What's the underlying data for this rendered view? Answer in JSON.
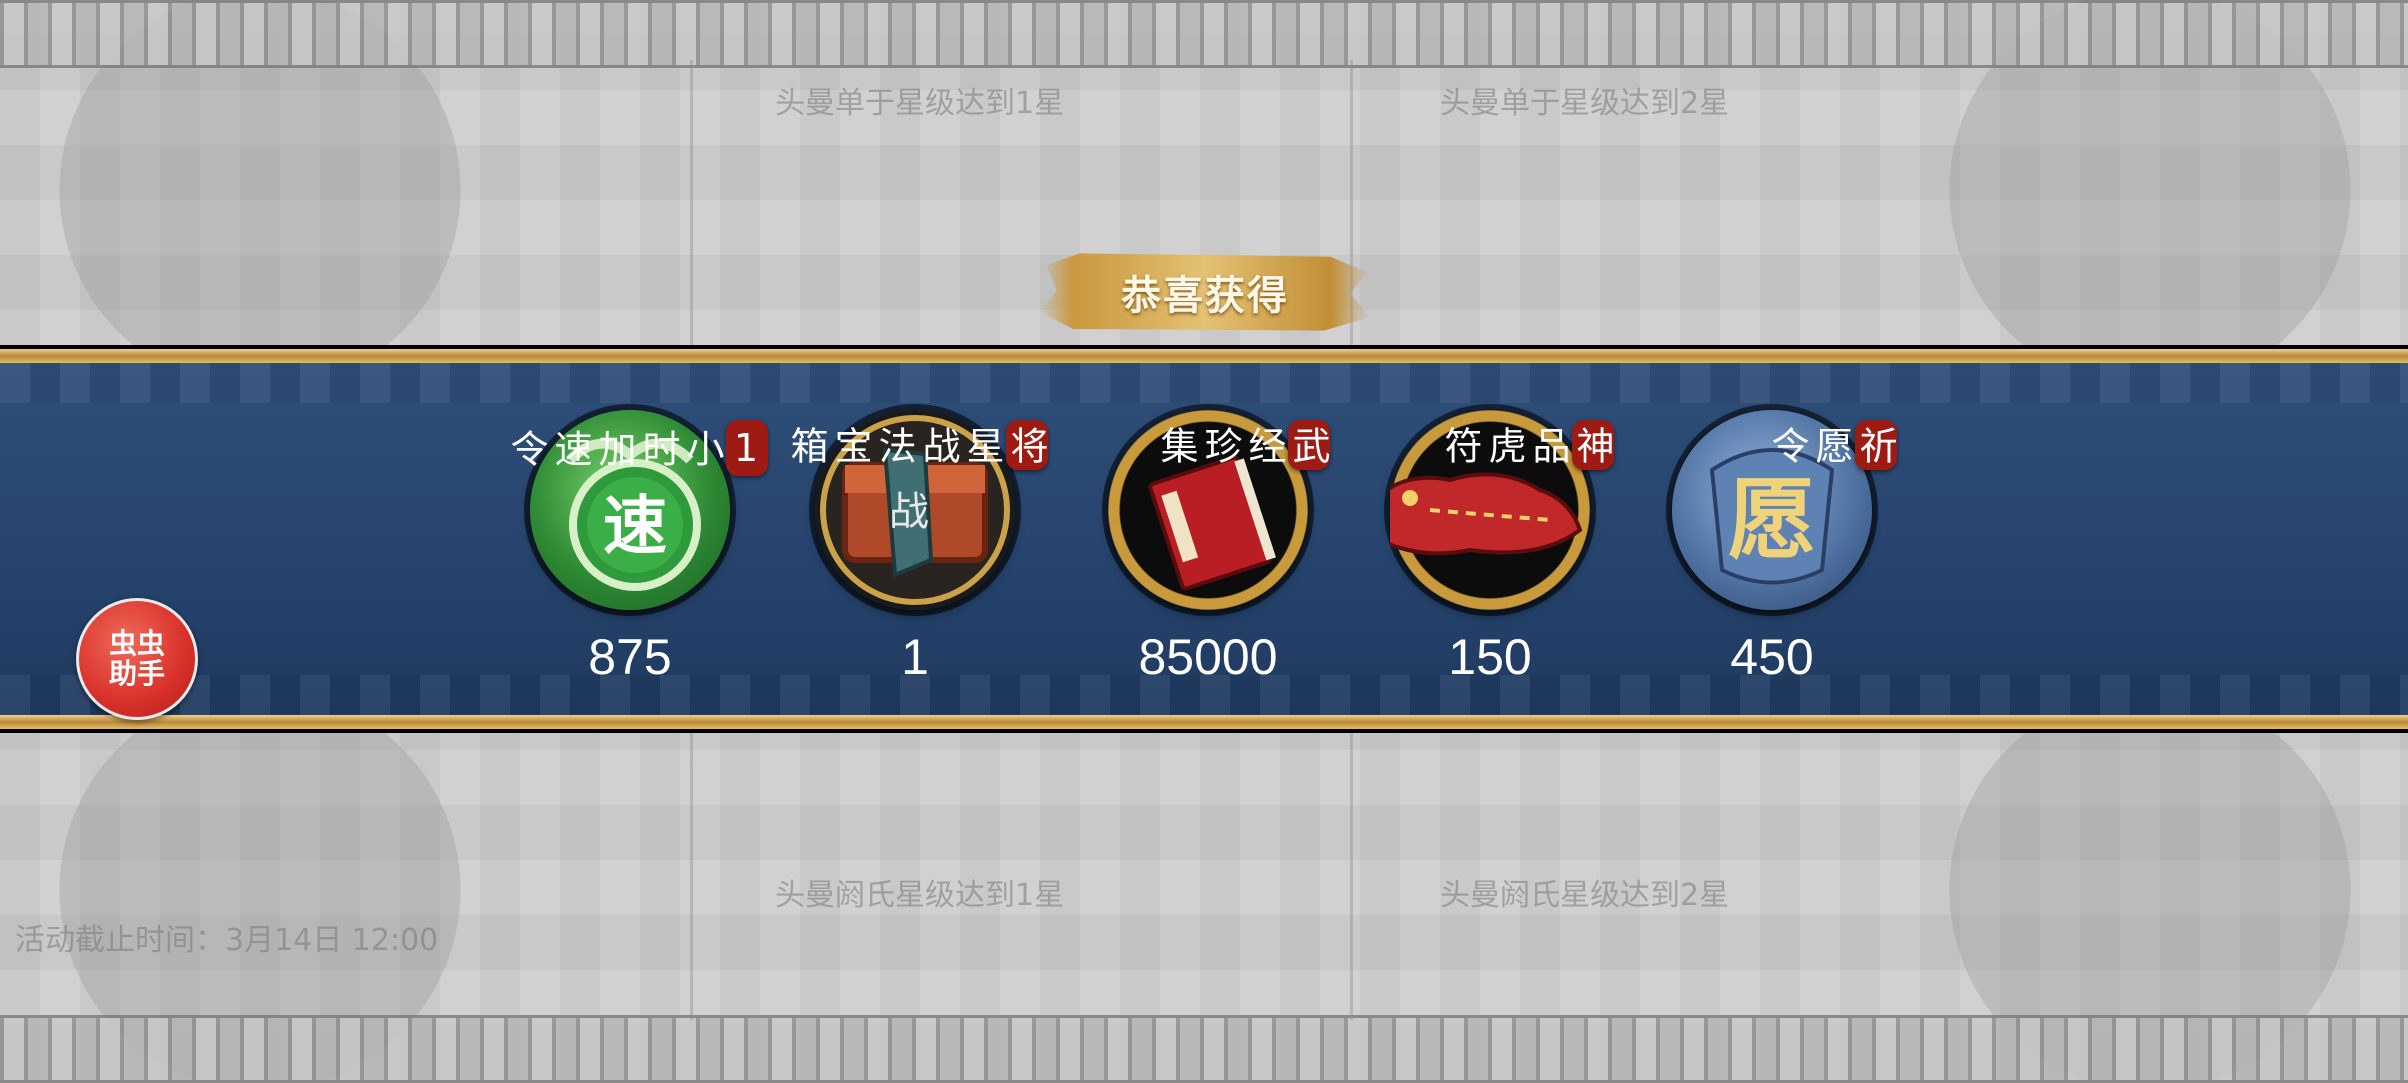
{
  "background_hints": {
    "top_left": "头曼单于星级达到1星",
    "top_right": "头曼单于星级达到2星",
    "bottom_left": "头曼阏氏星级达到1星",
    "bottom_right": "头曼阏氏星级达到2星",
    "event_time": "活动截止时间：3月14日 12:00"
  },
  "popup": {
    "title": "恭喜获得"
  },
  "rewards": [
    {
      "name": "1小时加速令",
      "count": "875",
      "icon": "speed-token-icon"
    },
    {
      "name": "将星战法宝箱",
      "count": "1",
      "icon": "tactic-chest-icon"
    },
    {
      "name": "武经珍集",
      "count": "85000",
      "icon": "war-manual-book-icon"
    },
    {
      "name": "神品虎符",
      "count": "150",
      "icon": "tiger-tally-icon"
    },
    {
      "name": "祈愿令",
      "count": "450",
      "icon": "wish-token-icon"
    }
  ],
  "helper_button": {
    "label": "虫虫\n助手"
  },
  "colors": {
    "band_blue": "#284670",
    "gold": "#e2bc6a",
    "tag_red": "#9e1b14"
  }
}
